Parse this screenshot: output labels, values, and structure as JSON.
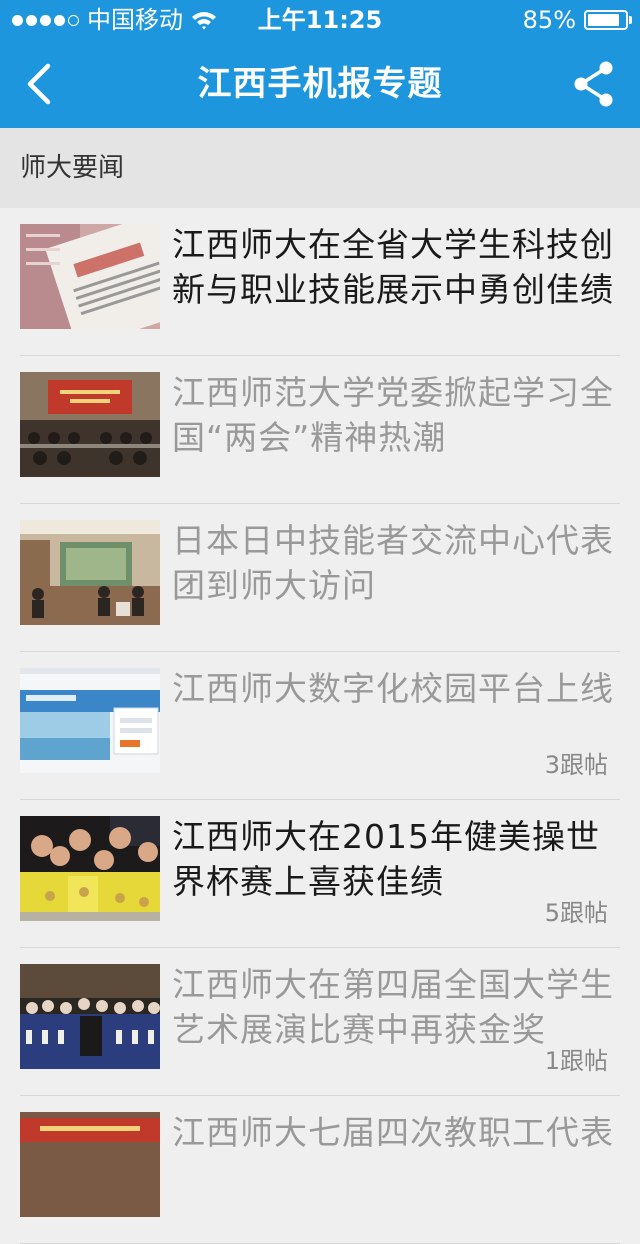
{
  "status_bar": {
    "carrier": "中国移动",
    "time": "上午11:25",
    "battery": "85%",
    "battery_level": 0.85
  },
  "nav": {
    "title": "江西手机报专题",
    "back_icon": "chevron-left-icon",
    "share_icon": "share-icon"
  },
  "section": {
    "title": "师大要闻"
  },
  "items": [
    {
      "title": "江西师大在全省大学生科技创新与职业技能展示中勇创佳绩",
      "replies": "",
      "read": false
    },
    {
      "title": "江西师范大学党委掀起学习全国“两会”精神热潮",
      "replies": "",
      "read": true
    },
    {
      "title": "日本日中技能者交流中心代表团到师大访问",
      "replies": "",
      "read": true
    },
    {
      "title": "江西师大数字化校园平台上线",
      "replies": "3跟帖",
      "read": true
    },
    {
      "title": "江西师大在2015年健美操世界杯赛上喜获佳绩",
      "replies": "5跟帖",
      "read": false
    },
    {
      "title": "江西师大在第四届全国大学生艺术展演比赛中再获金奖",
      "replies": "1跟帖",
      "read": true
    },
    {
      "title": "江西师大七届四次教职工代表",
      "replies": "",
      "read": true
    }
  ]
}
